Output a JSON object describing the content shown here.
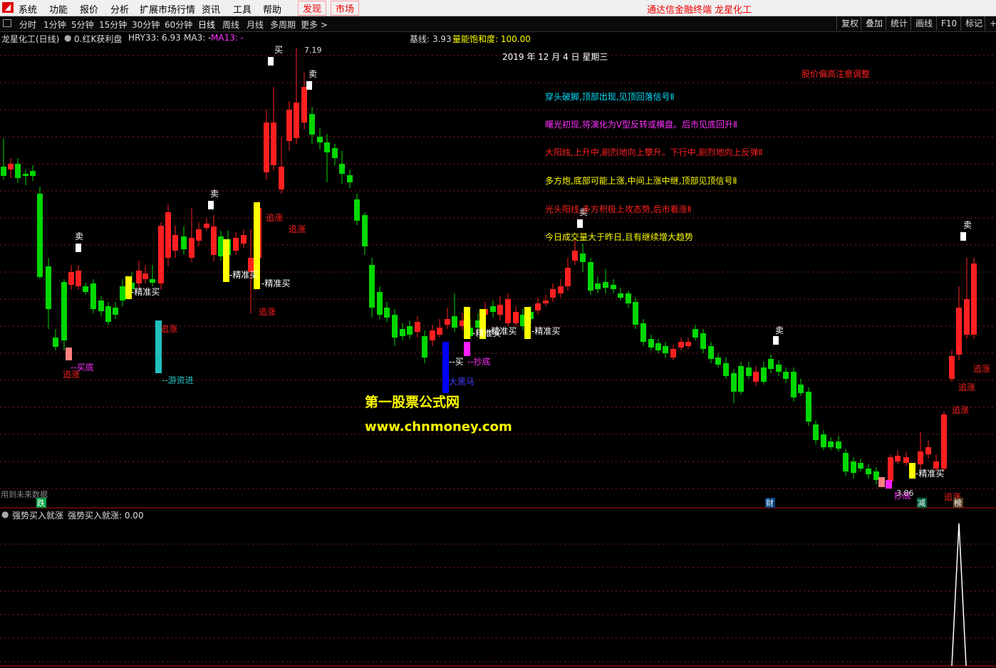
{
  "menu": {
    "items": [
      "系统",
      "功能",
      "报价",
      "分析",
      "扩展市场行情",
      "资讯",
      "工具",
      "帮助"
    ],
    "highlight": [
      "发现",
      "市场"
    ],
    "app_title": "通达信金融终端  龙星化工"
  },
  "periods": {
    "items": [
      "分时",
      "1分钟",
      "5分钟",
      "15分钟",
      "30分钟",
      "60分钟",
      "日线",
      "周线",
      "月线",
      "多周期",
      "更多 >"
    ],
    "active": "日线",
    "right_buttons": [
      "复权",
      "叠加",
      "统计",
      "画线",
      "F10",
      "标记",
      "+"
    ]
  },
  "info": {
    "stock": "龙星化工(日线)",
    "indicator": "0.红K获利盘",
    "hry": "HRY33: 6.93",
    "ma3": "MA3: -",
    "ma13": "MA13: -",
    "jixian": "基线: 3.93",
    "baohe": "量能饱和度: 100.00"
  },
  "chart": {
    "date": "2019 年 12 月 4 日 星期三",
    "high_label": "7.19",
    "low_label": "3.86",
    "future_note": "用到未来数据",
    "watermark1": "第一股票公式网",
    "watermark2": "www.chnmoney.com",
    "legend": [
      {
        "text": "股价偏高注意调整",
        "color": "#ff2020"
      },
      {
        "text": "穿头破脚,顶部出现,见顶回落信号Ⅱ",
        "color": "#00e0ff"
      },
      {
        "text": "曙光初现,将演化为V型反转或横盘。后市见底回升Ⅱ",
        "color": "#ff30ff"
      },
      {
        "text": "大阳烛,上升中,剧烈地向上攀升。下行中,剧烈地向上反弹Ⅱ",
        "color": "#ff2020"
      },
      {
        "text": "多方炮,底部可能上涨,中间上涨中继,顶部见顶信号Ⅱ",
        "color": "#ffff00"
      },
      {
        "text": "光头阳线,多方积极上攻态势,后市看涨Ⅱ",
        "color": "#ff2020"
      },
      {
        "text": "今日成交量大于昨日,且有继续增大趋势",
        "color": "#ffff00"
      }
    ],
    "signals": {
      "sell": "卖",
      "buy": "买",
      "chase": "追涨",
      "precise_buy": "精准买",
      "bottom_fish": "--抄底",
      "hot_money": "--游资进",
      "dark_horse": "大黑马",
      "buy_dash": "--买",
      "buy_bottom": "--买底",
      "bottom_tag": "抄底"
    },
    "bottom_tags": [
      "跌",
      "财",
      "减",
      "榜"
    ],
    "colors": {
      "up": "#ff2020",
      "down": "#00d800",
      "yellow": "#ffff00",
      "grid": "#8b1a1a"
    }
  },
  "sub": {
    "title": "强势买入就涨",
    "value": "强势买入就涨: 0.00"
  }
}
